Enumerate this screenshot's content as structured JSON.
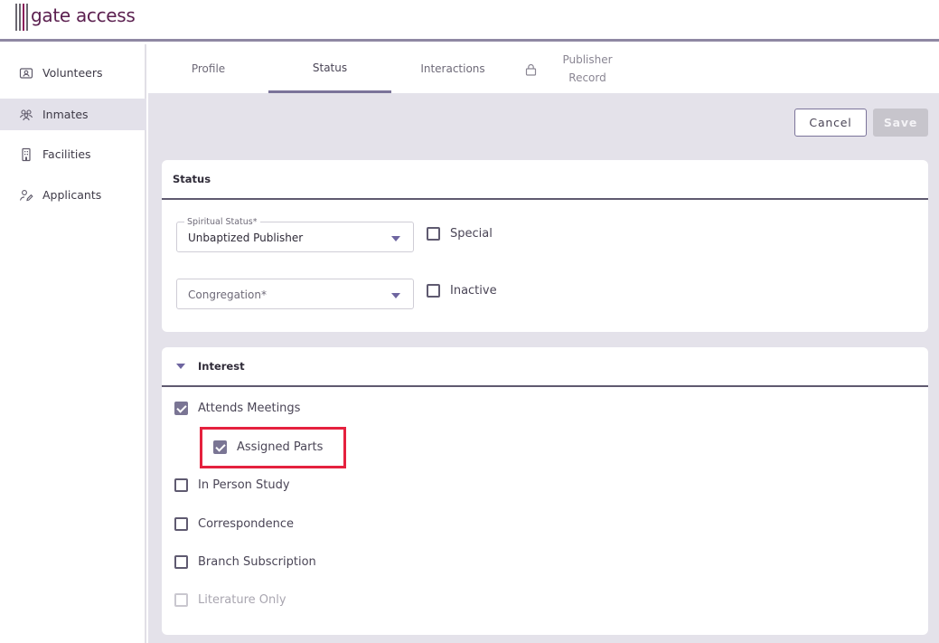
{
  "app": {
    "logo_text": "gate access"
  },
  "sidebar": {
    "items": [
      {
        "label": "Volunteers",
        "icon": "id-badge-icon"
      },
      {
        "label": "Inmates",
        "icon": "users-icon",
        "active": true
      },
      {
        "label": "Facilities",
        "icon": "building-icon"
      },
      {
        "label": "Applicants",
        "icon": "user-edit-icon"
      }
    ]
  },
  "tabs": [
    {
      "label": "Profile"
    },
    {
      "label": "Status",
      "active": true
    },
    {
      "label": "Interactions"
    },
    {
      "label_line1": "Publisher",
      "label_line2": "Record",
      "locked": true
    }
  ],
  "toolbar": {
    "cancel_label": "Cancel",
    "save_label": "Save"
  },
  "status_card": {
    "title": "Status",
    "spiritual_status": {
      "label": "Spiritual Status*",
      "value": "Unbaptized Publisher"
    },
    "congregation": {
      "placeholder": "Congregation*"
    },
    "special": {
      "label": "Special",
      "checked": false
    },
    "inactive": {
      "label": "Inactive",
      "checked": false
    }
  },
  "interest_card": {
    "title": "Interest",
    "items": [
      {
        "label": "Attends Meetings",
        "checked": true
      },
      {
        "label": "Assigned Parts",
        "checked": true,
        "indented": true
      },
      {
        "label": "In Person Study",
        "checked": false
      },
      {
        "label": "Correspondence",
        "checked": false
      },
      {
        "label": "Branch Subscription",
        "checked": false
      },
      {
        "label": "Literature Only",
        "checked": false,
        "disabled": true
      }
    ]
  },
  "colors": {
    "accent": "#7b749a",
    "highlight": "#e5213e",
    "logo": "#5b1f4f",
    "main_bg": "#e4e2ea"
  }
}
